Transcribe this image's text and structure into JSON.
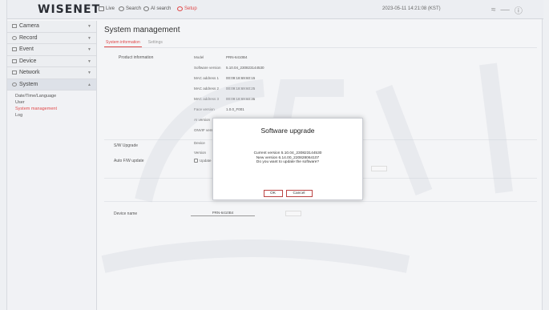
{
  "app": {
    "logo": "WISENET",
    "toplinks": [
      {
        "label": "Live",
        "icon": "monitor-icon",
        "active": false
      },
      {
        "label": "Search",
        "icon": "search-icon",
        "active": false
      },
      {
        "label": "AI search",
        "icon": "ai-search-icon",
        "active": false
      },
      {
        "label": "Setup",
        "icon": "gear-icon",
        "active": true
      }
    ],
    "timestamp": "2023-05-11 14:21:08 (KST)"
  },
  "sidebar": {
    "items": [
      {
        "label": "Camera",
        "icon": "camera-icon"
      },
      {
        "label": "Record",
        "icon": "record-icon"
      },
      {
        "label": "Event",
        "icon": "event-icon"
      },
      {
        "label": "Device",
        "icon": "device-icon"
      },
      {
        "label": "Network",
        "icon": "network-icon"
      },
      {
        "label": "System",
        "icon": "system-icon"
      }
    ],
    "submenu": [
      {
        "label": "Date/Time/Language",
        "active": false
      },
      {
        "label": "User",
        "active": false
      },
      {
        "label": "System management",
        "active": true
      },
      {
        "label": "Log",
        "active": false
      }
    ]
  },
  "main": {
    "title": "System management",
    "tabs": [
      {
        "label": "System information",
        "active": true
      },
      {
        "label": "Settings",
        "active": false
      }
    ],
    "product_section": "Product information",
    "product_fields": [
      {
        "key": "Model",
        "value": "PRN-6410B4"
      },
      {
        "key": "Software version",
        "value": "5.10.04_230823144530"
      },
      {
        "key": "MAC address 1",
        "value": "00:09:18:69:60:15"
      },
      {
        "key": "MAC address 2",
        "value": "00:09:18:69:60:25"
      },
      {
        "key": "MAC address 3",
        "value": "00:09:18:69:60:35"
      },
      {
        "key": "Face version",
        "value": "1.0.0_F001"
      },
      {
        "key": "AI version",
        "value": ""
      },
      {
        "key": "ONVIF version",
        "value": ""
      }
    ],
    "sw_upgrade_label": "S/W Upgrade",
    "sw_upgrade_rows": [
      {
        "key": "Device",
        "value": ""
      },
      {
        "key": "Version",
        "value": ""
      }
    ],
    "auto_upgrade_label": "Auto F/W update",
    "auto_upgrade_option": "Update auto",
    "device_name_label": "Device name",
    "device_name_value": "PRN-6410B4"
  },
  "modal": {
    "title": "Software upgrade",
    "lines": [
      "Current version 5.10.04_230823144530",
      "New version 6.14.00_220828064107",
      "Do you want to update the software?"
    ],
    "ok_label": "OK",
    "cancel_label": "Cancel"
  },
  "colors": {
    "accent": "#e04848",
    "modal_border": "#b44444"
  }
}
